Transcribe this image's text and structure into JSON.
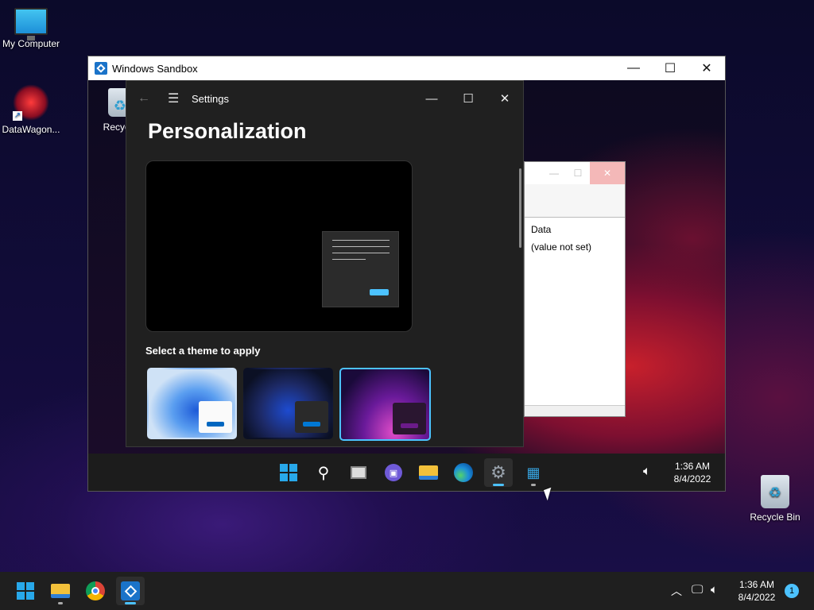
{
  "desktop": {
    "icons": [
      {
        "label": "My Computer",
        "icon": "monitor-icon"
      },
      {
        "label": "DataWagon...",
        "icon": "datawagon-icon"
      },
      {
        "label": "Recycle Bin",
        "icon": "recycle-bin-icon"
      }
    ]
  },
  "sandbox": {
    "title": "Windows Sandbox",
    "controls": {
      "minimize": "—",
      "maximize": "☐",
      "close": "✕"
    },
    "desktop_icon_label": "Recycle",
    "registry_panel": {
      "data_header": "Data",
      "data_value": "(value not set)"
    },
    "settings": {
      "back_icon": "←",
      "menu_icon": "☰",
      "title": "Settings",
      "heading": "Personalization",
      "select_theme_label": "Select a theme to apply",
      "themes": [
        {
          "name": "windows-light",
          "accent": "#0067c0"
        },
        {
          "name": "windows-dark",
          "accent": "#0078d4"
        },
        {
          "name": "glow",
          "accent": "#6b1b8a",
          "selected": true
        }
      ]
    },
    "taskbar": {
      "apps": [
        "start-icon",
        "search-icon",
        "task-view-icon",
        "chat-icon",
        "file-explorer-icon",
        "edge-icon",
        "settings-icon",
        "registry-editor-icon"
      ],
      "time": "1:36 AM",
      "date": "8/4/2022"
    }
  },
  "taskbar": {
    "apps": [
      "start-icon",
      "file-explorer-icon",
      "chrome-icon",
      "windows-sandbox-icon"
    ],
    "time": "1:36 AM",
    "date": "8/4/2022",
    "notification_count": "1"
  },
  "colors": {
    "accent": "#4cc2ff",
    "settings_bg": "#202020",
    "taskbar_bg": "#1c1c1c"
  }
}
